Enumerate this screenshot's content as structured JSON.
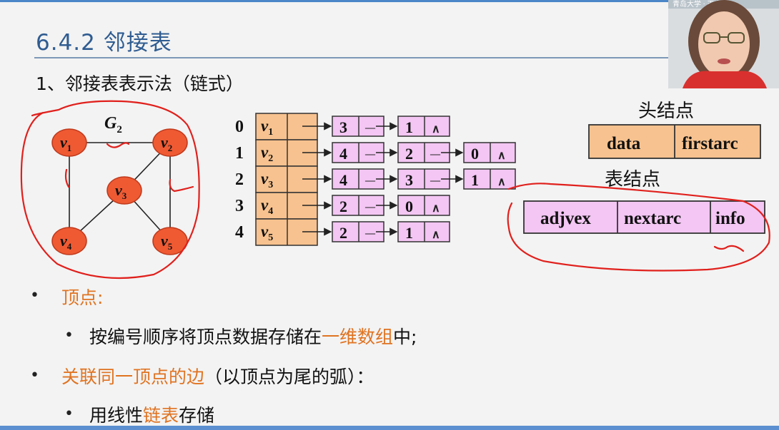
{
  "slide": {
    "title": "6.4.2 邻接表",
    "subtitle": "1、邻接表表示法（链式）"
  },
  "graph": {
    "name": "G",
    "name_sub": "2",
    "vertices": [
      {
        "label": "v",
        "sub": "1"
      },
      {
        "label": "v",
        "sub": "2"
      },
      {
        "label": "v",
        "sub": "3"
      },
      {
        "label": "v",
        "sub": "4"
      },
      {
        "label": "v",
        "sub": "5"
      }
    ]
  },
  "adjacency": {
    "rows": [
      {
        "index": "0",
        "vertex": "v",
        "sub": "1",
        "list": [
          "3",
          "1"
        ]
      },
      {
        "index": "1",
        "vertex": "v",
        "sub": "2",
        "list": [
          "4",
          "2",
          "0"
        ]
      },
      {
        "index": "2",
        "vertex": "v",
        "sub": "3",
        "list": [
          "4",
          "3",
          "1"
        ]
      },
      {
        "index": "3",
        "vertex": "v",
        "sub": "4",
        "list": [
          "2",
          "0"
        ]
      },
      {
        "index": "4",
        "vertex": "v",
        "sub": "5",
        "list": [
          "2",
          "1"
        ]
      }
    ],
    "null_symbol": "∧",
    "dash": "—"
  },
  "head_node": {
    "caption": "头结点",
    "fields": [
      "data",
      "firstarc"
    ]
  },
  "table_node": {
    "caption": "表结点",
    "fields": [
      "adjvex",
      "nextarc",
      "info"
    ]
  },
  "bullets": {
    "b1_label": "顶点:",
    "b1_sub_pre": "按编号顺序将顶点数据存储在",
    "b1_sub_hl": "一维数组",
    "b1_sub_post": "中;",
    "b2_hl": "关联同一顶点的边",
    "b2_rest": "（以顶点为尾的弧）：",
    "b2_sub_pre": "用线性",
    "b2_sub_hl": "链表",
    "b2_sub_post": "存储"
  },
  "webcam": {
    "overlay_text": "青岛大学 · 王卓"
  },
  "colors": {
    "title": "#2f5c91",
    "highlight": "#e07321",
    "vertex_fill": "#ef5a33",
    "head_fill": "#f7c28f",
    "node_fill": "#f3c6f3",
    "annotation": "#e0201c"
  }
}
